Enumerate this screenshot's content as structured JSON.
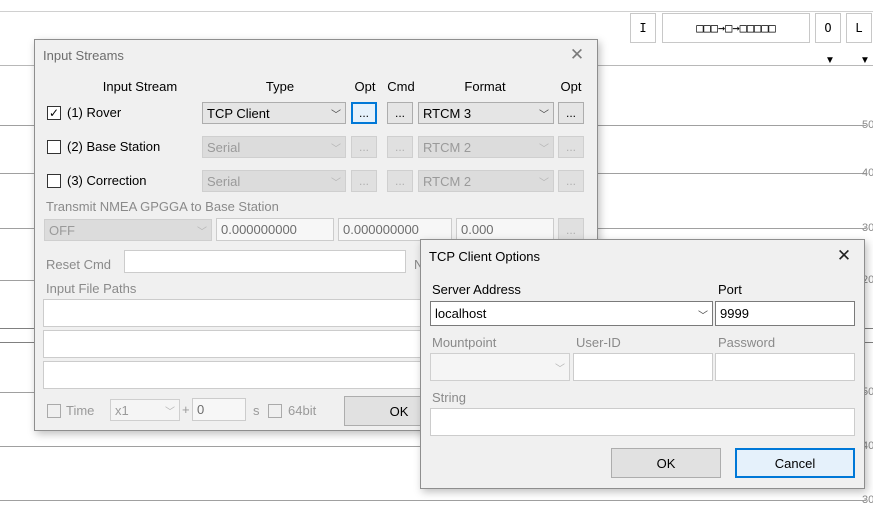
{
  "background": {
    "toolbar_buttons": [
      "I",
      "□□□→□→□□□□□",
      "O",
      "L"
    ],
    "axis_ticks": [
      "50",
      "40",
      "30",
      "20",
      "50",
      "40",
      "30"
    ]
  },
  "input_streams": {
    "title": "Input Streams",
    "headers": {
      "stream": "Input Stream",
      "type": "Type",
      "opt1": "Opt",
      "cmd": "Cmd",
      "format": "Format",
      "opt2": "Opt"
    },
    "rows": [
      {
        "label": "(1) Rover",
        "checked": true,
        "type": "TCP Client",
        "format": "RTCM 3",
        "opt_btn": "...",
        "cmd_btn": "...",
        "opt2_btn": "..."
      },
      {
        "label": "(2) Base Station",
        "checked": false,
        "type": "Serial",
        "format": "RTCM 2",
        "opt_btn": "...",
        "cmd_btn": "...",
        "opt2_btn": "..."
      },
      {
        "label": "(3) Correction",
        "checked": false,
        "type": "Serial",
        "format": "RTCM 2",
        "opt_btn": "...",
        "cmd_btn": "...",
        "opt2_btn": "..."
      }
    ],
    "nmea": {
      "label": "Transmit NMEA GPGGA to Base Station",
      "mode": "OFF",
      "lat": "0.000000000",
      "lon": "0.000000000",
      "height": "0.000",
      "btn": "..."
    },
    "reset_cmd_label": "Reset Cmd",
    "reset_partial_label": "N",
    "input_file_paths_label": "Input File Paths",
    "time": {
      "label": "Time",
      "speed": "x1",
      "plus": "+",
      "offset": "0",
      "unit": "s",
      "bit_label": "64bit"
    },
    "ok_label": "OK"
  },
  "tcp_options": {
    "title": "TCP Client Options",
    "server_address_label": "Server Address",
    "server_address_value": "localhost",
    "port_label": "Port",
    "port_value": "9999",
    "mountpoint_label": "Mountpoint",
    "userid_label": "User-ID",
    "password_label": "Password",
    "string_label": "String",
    "ok_label": "OK",
    "cancel_label": "Cancel"
  },
  "colors": {
    "dialog_bg": "#f0f0f0",
    "accent": "#0078d7",
    "disabled_text": "#9a9a9a"
  }
}
